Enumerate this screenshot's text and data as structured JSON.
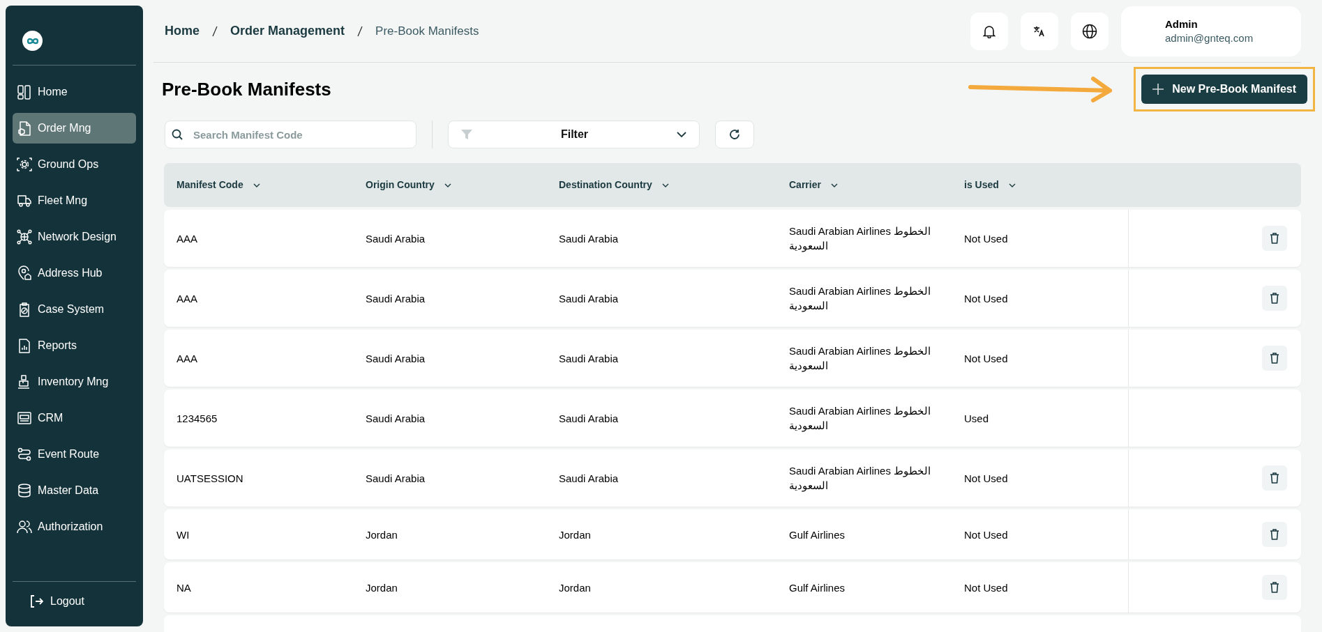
{
  "sidebar": {
    "items": [
      {
        "label": "Home",
        "selected": false
      },
      {
        "label": "Order Mng",
        "selected": true
      },
      {
        "label": "Ground Ops",
        "selected": false
      },
      {
        "label": "Fleet Mng",
        "selected": false
      },
      {
        "label": "Network Design",
        "selected": false
      },
      {
        "label": "Address Hub",
        "selected": false
      },
      {
        "label": "Case System",
        "selected": false
      },
      {
        "label": "Reports",
        "selected": false
      },
      {
        "label": "Inventory Mng",
        "selected": false
      },
      {
        "label": "CRM",
        "selected": false
      },
      {
        "label": "Event Route",
        "selected": false
      },
      {
        "label": "Master Data",
        "selected": false
      },
      {
        "label": "Authorization",
        "selected": false
      }
    ],
    "logout": "Logout"
  },
  "breadcrumb": [
    "Home",
    "Order Management",
    "Pre-Book Manifests"
  ],
  "user": {
    "name": "Admin",
    "email": "admin@gnteq.com"
  },
  "page_title": "Pre-Book Manifests",
  "new_button": "New Pre-Book Manifest",
  "search": {
    "placeholder": "Search Manifest Code"
  },
  "filter": "Filter",
  "table": {
    "columns": [
      "Manifest Code",
      "Origin Country",
      "Destination Country",
      "Carrier",
      "is Used"
    ],
    "rows": [
      {
        "cells": [
          "AAA",
          "Saudi Arabia",
          "Saudi Arabia",
          "Saudi Arabian Airlines الخطوط السعودية",
          "Not Used"
        ],
        "deletable": true
      },
      {
        "cells": [
          "AAA",
          "Saudi Arabia",
          "Saudi Arabia",
          "Saudi Arabian Airlines الخطوط السعودية",
          "Not Used"
        ],
        "deletable": true
      },
      {
        "cells": [
          "AAA",
          "Saudi Arabia",
          "Saudi Arabia",
          "Saudi Arabian Airlines الخطوط السعودية",
          "Not Used"
        ],
        "deletable": true
      },
      {
        "cells": [
          "1234565",
          "Saudi Arabia",
          "Saudi Arabia",
          "Saudi Arabian Airlines الخطوط السعودية",
          "Used"
        ],
        "deletable": false
      },
      {
        "cells": [
          "UATSESSION",
          "Saudi Arabia",
          "Saudi Arabia",
          "Saudi Arabian Airlines الخطوط السعودية",
          "Not Used"
        ],
        "deletable": true
      },
      {
        "cells": [
          "WI",
          "Jordan",
          "Jordan",
          "Gulf Airlines",
          "Not Used"
        ],
        "deletable": true
      },
      {
        "cells": [
          "NA",
          "Jordan",
          "Jordan",
          "Gulf Airlines",
          "Not Used"
        ],
        "deletable": true
      }
    ]
  }
}
